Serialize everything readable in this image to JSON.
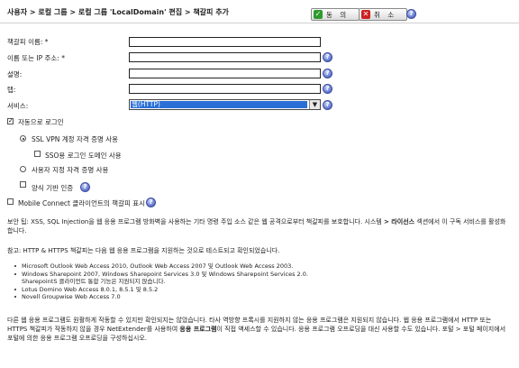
{
  "header": {
    "breadcrumb": "사용자 > 로컬 그룹 > 로컬 그룹 'LocalDomain' 편집 > 책갈피 추가",
    "ok_label": "동 의",
    "cancel_label": "취 소"
  },
  "form": {
    "bookmark_name": {
      "label": "책갈피 이름: *",
      "value": ""
    },
    "host": {
      "label": "이름 또는 IP 주소: *",
      "value": ""
    },
    "description": {
      "label": "설명:",
      "value": ""
    },
    "tab": {
      "label": "탭:",
      "value": ""
    },
    "service": {
      "label": "서비스:",
      "selected": "웹(HTTP)"
    },
    "auto_login": {
      "label": "자동으로 로그인",
      "checked": true
    },
    "sso_credentials": {
      "label": "SSL VPN 계정 자격 증명 사용",
      "selected": true
    },
    "sso_domain": {
      "label": "SSO용 로그인 도메인 사용",
      "checked": false
    },
    "custom_credentials": {
      "label": "사용자 지정 자격 증명 사용",
      "selected": false
    },
    "form_auth": {
      "label": "양식 기반 인증",
      "checked": false
    },
    "mobile_connect": {
      "label": "Mobile Connect 클라이언트의 책갈피 표시",
      "checked": false
    }
  },
  "notes": {
    "security_prefix": "보안 팁: XSS, SQL Injection을 웹 응용 프로그램 방화벽을 사용하는 기타 명령 주입 소스 같은 웹 공격으로부터 책갈피를 보호합니다. 시스템 ",
    "security_path": "> 라이선스",
    "security_suffix": " 섹션에서 이 구독 서비스를 활성화합니다.",
    "reference_intro": "참고: HTTP & HTTPS 책갈피는 다음 웹 응용 프로그램을 지원하는 것으로 테스트되고 확인되었습니다.",
    "apps": [
      "Microsoft Outlook Web Access 2010, Outlook Web Access 2007 및 Outlook Web Access 2003.",
      "Windows Sharepoint 2007, Windows Sharepoint Services 3.0 및 Windows Sharepoint Services 2.0.",
      "SharepointS 클라이언트 통합 기능은 지원되지 않습니다.",
      "Lotus Domino Web Access 8.0.1, 8.5.1 및 8.5.2",
      "Novell Groupwise Web Access 7.0"
    ],
    "footer_part1": "다른 웹 응용 프로그램도 원활하게 작동할 수 있지만 확인되지는 않았습니다. 타사 역방향 프록시를 지원하지 않는 응용 프로그램은 지원되지 않습니다. 웹 응용 프로그램에서 HTTP 또는 HTTPS 책갈피가 작동하지 않을 경우 NetExtender를 사용하여 ",
    "footer_bold": "응용 프로그램",
    "footer_part2": "이 직접 액세스할 수 있습니다. 응용 프로그램 오프로딩을 대신 사용할 수도 있습니다. 포털 > 포털 페이지에서 포털에 의한 응용 프로그램 오프로딩을 구성하십시오."
  },
  "colors": {
    "selected_option": "#2a6fd6",
    "ok_icon": "#2e9b2e",
    "cancel_icon": "#cc2222",
    "help_icon": "#5a6fc8"
  },
  "icons": [
    "check-icon",
    "close-icon",
    "help-icon",
    "chevron-down-icon"
  ]
}
